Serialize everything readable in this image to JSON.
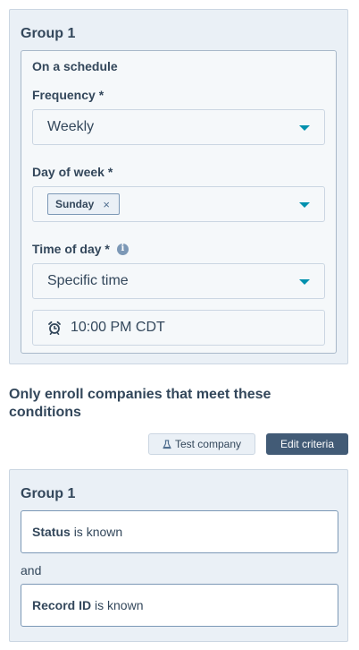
{
  "schedule_group": {
    "title": "Group 1",
    "trigger_title": "On a schedule",
    "frequency": {
      "label": "Frequency *",
      "value": "Weekly"
    },
    "day_of_week": {
      "label": "Day of week *",
      "tag": "Sunday",
      "remove_glyph": "×"
    },
    "time_of_day": {
      "label": "Time of day *",
      "info_glyph": "i",
      "value": "Specific time"
    },
    "time_value": "10:00 PM CDT"
  },
  "enroll": {
    "heading": "Only enroll companies that meet these conditions",
    "test_button": "Test company",
    "edit_button": "Edit criteria"
  },
  "criteria_group": {
    "title": "Group 1",
    "conditions": [
      {
        "property": "Status",
        "operator": "is known"
      },
      {
        "property": "Record ID",
        "operator": "is known"
      }
    ],
    "joiner": "and"
  },
  "colors": {
    "panel_bg": "#eaf0f6",
    "text": "#33475b",
    "accent_caret": "#0091ae",
    "primary_button": "#425b76"
  },
  "icons": [
    "chevron-down-icon",
    "close-icon",
    "info-icon",
    "alarm-clock-icon",
    "flask-icon"
  ]
}
